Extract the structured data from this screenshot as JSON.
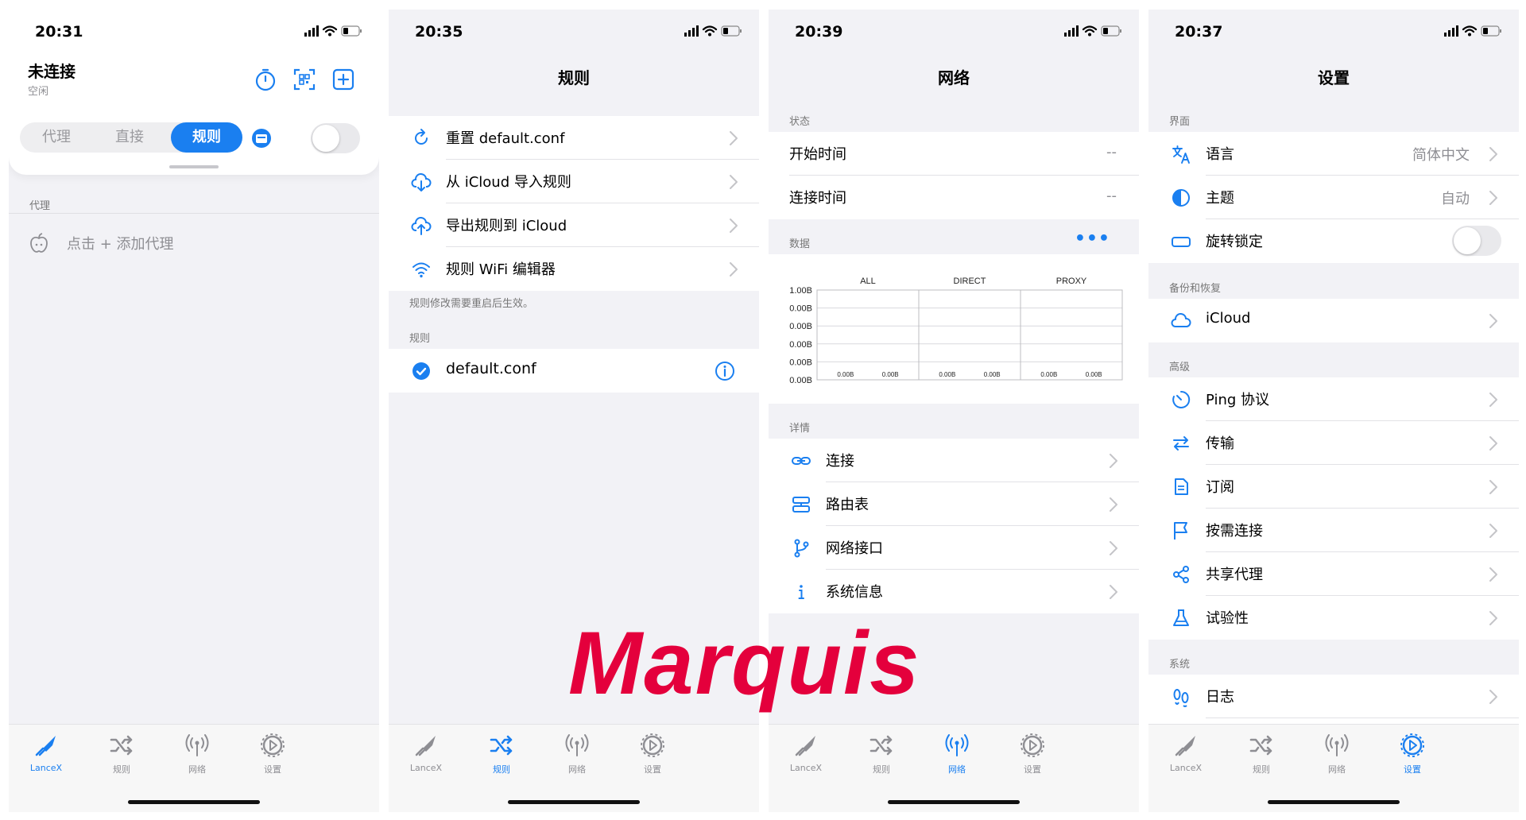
{
  "watermark": "Marquis",
  "colors": {
    "accent": "#1a7ff0",
    "watermark": "#e4003c"
  },
  "tabs": [
    {
      "label": "LanceX",
      "icon": "rocket-icon"
    },
    {
      "label": "规则",
      "icon": "shuffle-icon"
    },
    {
      "label": "网络",
      "icon": "antenna-icon"
    },
    {
      "label": "设置",
      "icon": "gear-icon"
    }
  ],
  "s1": {
    "time": "20:31",
    "title": "未连接",
    "subtitle": "空闲",
    "modes": [
      "代理",
      "直接",
      "规则"
    ],
    "selected_mode": "规则",
    "section": "代理",
    "add_proxy": "点击 + 添加代理",
    "active_tab": 0
  },
  "s2": {
    "time": "20:35",
    "title": "规则",
    "actions": [
      {
        "label": "重置 default.conf",
        "icon": "refresh-icon"
      },
      {
        "label": "从 iCloud 导入规则",
        "icon": "cloud-download-icon"
      },
      {
        "label": "导出规则到 iCloud",
        "icon": "cloud-upload-icon"
      },
      {
        "label": "规则 WiFi 编辑器",
        "icon": "wifi-icon"
      }
    ],
    "note": "规则修改需要重启后生效。",
    "section": "规则",
    "rule_file": "default.conf",
    "active_tab": 1
  },
  "s3": {
    "time": "20:39",
    "title": "网络",
    "status_section": "状态",
    "status_rows": [
      {
        "label": "开始时间",
        "value": "--"
      },
      {
        "label": "连接时间",
        "value": "--"
      }
    ],
    "data_section": "数据",
    "chart_data": {
      "type": "bar",
      "categories": [
        "ALL",
        "DIRECT",
        "PROXY"
      ],
      "series": [
        {
          "values": [
            0,
            0,
            0
          ]
        },
        {
          "values": [
            0,
            0,
            0
          ]
        }
      ],
      "ytick_labels": [
        "1.00B",
        "0.00B",
        "0.00B",
        "0.00B",
        "0.00B",
        "0.00B"
      ],
      "bar_labels": [
        "0.00B",
        "0.00B",
        "0.00B",
        "0.00B",
        "0.00B",
        "0.00B"
      ],
      "ylim": [
        0,
        1
      ],
      "grid": true
    },
    "details_section": "详情",
    "detail_rows": [
      {
        "label": "连接",
        "icon": "link-icon"
      },
      {
        "label": "路由表",
        "icon": "route-icon"
      },
      {
        "label": "网络接口",
        "icon": "branch-icon"
      },
      {
        "label": "系统信息",
        "icon": "info-icon"
      }
    ],
    "active_tab": 2
  },
  "s4": {
    "time": "20:37",
    "title": "设置",
    "sec_ui": "界面",
    "ui_rows": [
      {
        "label": "语言",
        "value": "简体中文",
        "icon": "translate-icon"
      },
      {
        "label": "主题",
        "value": "自动",
        "icon": "theme-icon"
      },
      {
        "label": "旋转锁定",
        "value": "",
        "icon": "rotation-lock-icon"
      }
    ],
    "sec_backup": "备份和恢复",
    "backup_rows": [
      {
        "label": "iCloud",
        "icon": "cloud-icon"
      }
    ],
    "sec_adv": "高级",
    "adv_rows": [
      {
        "label": "Ping 协议",
        "icon": "timer-icon"
      },
      {
        "label": "传输",
        "icon": "transfer-icon"
      },
      {
        "label": "订阅",
        "icon": "document-icon"
      },
      {
        "label": "按需连接",
        "icon": "flag-icon"
      },
      {
        "label": "共享代理",
        "icon": "share-icon"
      },
      {
        "label": "试验性",
        "icon": "flask-icon"
      }
    ],
    "sec_sys": "系统",
    "sys_rows": [
      {
        "label": "日志",
        "icon": "footprints-icon"
      }
    ],
    "active_tab": 3
  }
}
